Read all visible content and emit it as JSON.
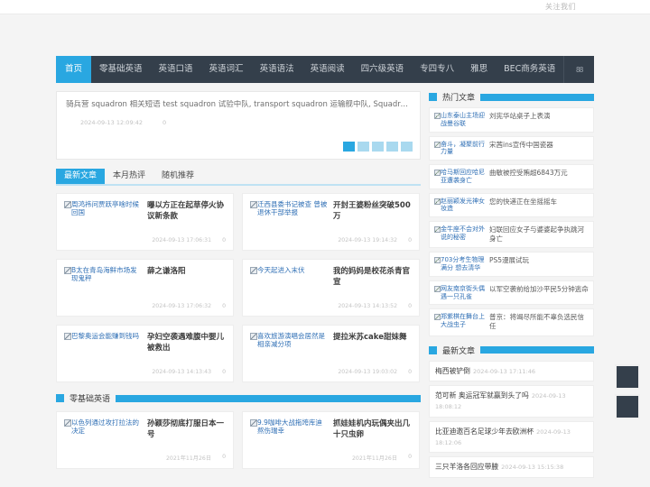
{
  "topbar": {
    "follow_label": "关注我们"
  },
  "nav": {
    "items": [
      {
        "label": "首页",
        "active": true
      },
      {
        "label": "零基础英语",
        "active": false
      },
      {
        "label": "英语口语",
        "active": false
      },
      {
        "label": "英语词汇",
        "active": false
      },
      {
        "label": "英语语法",
        "active": false
      },
      {
        "label": "英语阅读",
        "active": false
      },
      {
        "label": "四六级英语",
        "active": false
      },
      {
        "label": "专四专八",
        "active": false
      },
      {
        "label": "雅思",
        "active": false
      },
      {
        "label": "BEC商务英语",
        "active": false
      }
    ],
    "search_glyph": "88"
  },
  "slider": {
    "title": "骑兵营  squadron 相关短语  test squadron 试验中队, transport squadron 运输舰中队, Squadron Leade ...",
    "date": "2024-09-13 12:09:42",
    "comments": "0",
    "dots": [
      "1",
      "2",
      "3",
      "4",
      "5"
    ],
    "active_dot": 0
  },
  "tabs": [
    {
      "label": "最新文章",
      "active": true
    },
    {
      "label": "本月热评",
      "active": false
    },
    {
      "label": "随机推荐",
      "active": false
    }
  ],
  "articles": [
    {
      "thumb_alt": "周鸿祎问贾跃亭啥时候回国",
      "title": "曝以方正在起草停火协议新条款",
      "date": "2024-09-13 17:06:31",
      "comments": "0"
    },
    {
      "thumb_alt": "迁西县委书记被查 曾被退休干部举报",
      "title": "开封王婆粉丝突破500万",
      "date": "2024-09-13 19:14:32",
      "comments": "0"
    },
    {
      "thumb_alt": "B太在青岛海鲜市场发现鬼秤",
      "title": "薛之谦洛阳",
      "date": "2024-09-13 17:06:32",
      "comments": "0"
    },
    {
      "thumb_alt": "今天起进入末伏",
      "title": "我的妈妈是校花杀青官宣",
      "date": "2024-09-13 14:13:52",
      "comments": "0"
    },
    {
      "thumb_alt": "巴黎奥运会能赚到钱吗",
      "title": "孕妇空袭遇难腹中婴儿被救出",
      "date": "2024-09-13 14:13:43",
      "comments": "0"
    },
    {
      "thumb_alt": "喜欢旅游演唱会居然是相亲减分项",
      "title": "提拉米苏cake甜妹舞",
      "date": "2024-09-13 19:03:02",
      "comments": "0"
    }
  ],
  "section_basic": {
    "title": "零基础英语",
    "articles": [
      {
        "thumb_alt": "以色列通过攻打拉法的决定",
        "title": "孙颖莎彻底打服日本一号",
        "date": "2021年11月26日",
        "comments": "0"
      },
      {
        "thumb_alt": "9.9咖啡大战拖垮库迪熬伤瑞幸",
        "title": "抓娃娃机内玩偶夹出几十只虫卵",
        "date": "2021年11月26日",
        "comments": "0"
      }
    ]
  },
  "sidebar": {
    "hot": {
      "title": "热门文章",
      "items": [
        {
          "thumb_alt": "山东泰山主场迎战曼谷联",
          "title": "刘宪华站桌子上表演"
        },
        {
          "thumb_alt": "奋斗，凝聚前行力量",
          "title": "宋茜ins宣传中国瓷器"
        },
        {
          "thumb_alt": "哈马斯回应哈尼亚遭袭身亡",
          "title": "曲敏被控受贿超6843万元"
        },
        {
          "thumb_alt": "赵丽颖发光神女妆造",
          "title": "您的快递正在坐摇摇车"
        },
        {
          "thumb_alt": "金牛座不会对外说的秘密",
          "title": "妇联回应女子与婆婆起争执跳河身亡"
        },
        {
          "thumb_alt": "703分考生物理满分 想去清华",
          "title": "PS5漫展试玩"
        },
        {
          "thumb_alt": "网友南京街头偶遇一只孔雀",
          "title": "以军空袭前给加沙平民5分钟逃命"
        },
        {
          "thumb_alt": "郑紫棋在舞台上大战虫子",
          "title": "普京：将竭尽所能不辜负选民信任"
        }
      ]
    },
    "latest": {
      "title": "最新文章",
      "items": [
        {
          "title": "梅西被铲倒",
          "time": "2024-09-13 17:11:46"
        },
        {
          "title": "范可新 奥运冠军就赢到头了吗",
          "time": "2024-09-13 18:08:12"
        },
        {
          "title": "比亚迪邀百名足球少年去欧洲杯",
          "time": "2024-09-13 18:12:06"
        },
        {
          "title": "三只羊洛各回应带腋",
          "time": "2024-09-13 15:15:38"
        }
      ]
    }
  },
  "float_tools": [
    {
      "name": "back-to-top"
    },
    {
      "name": "qr-code"
    }
  ],
  "colors": {
    "accent": "#29a7e1",
    "nav_bg": "#343f4b",
    "page_bg": "#f4f4f4"
  }
}
